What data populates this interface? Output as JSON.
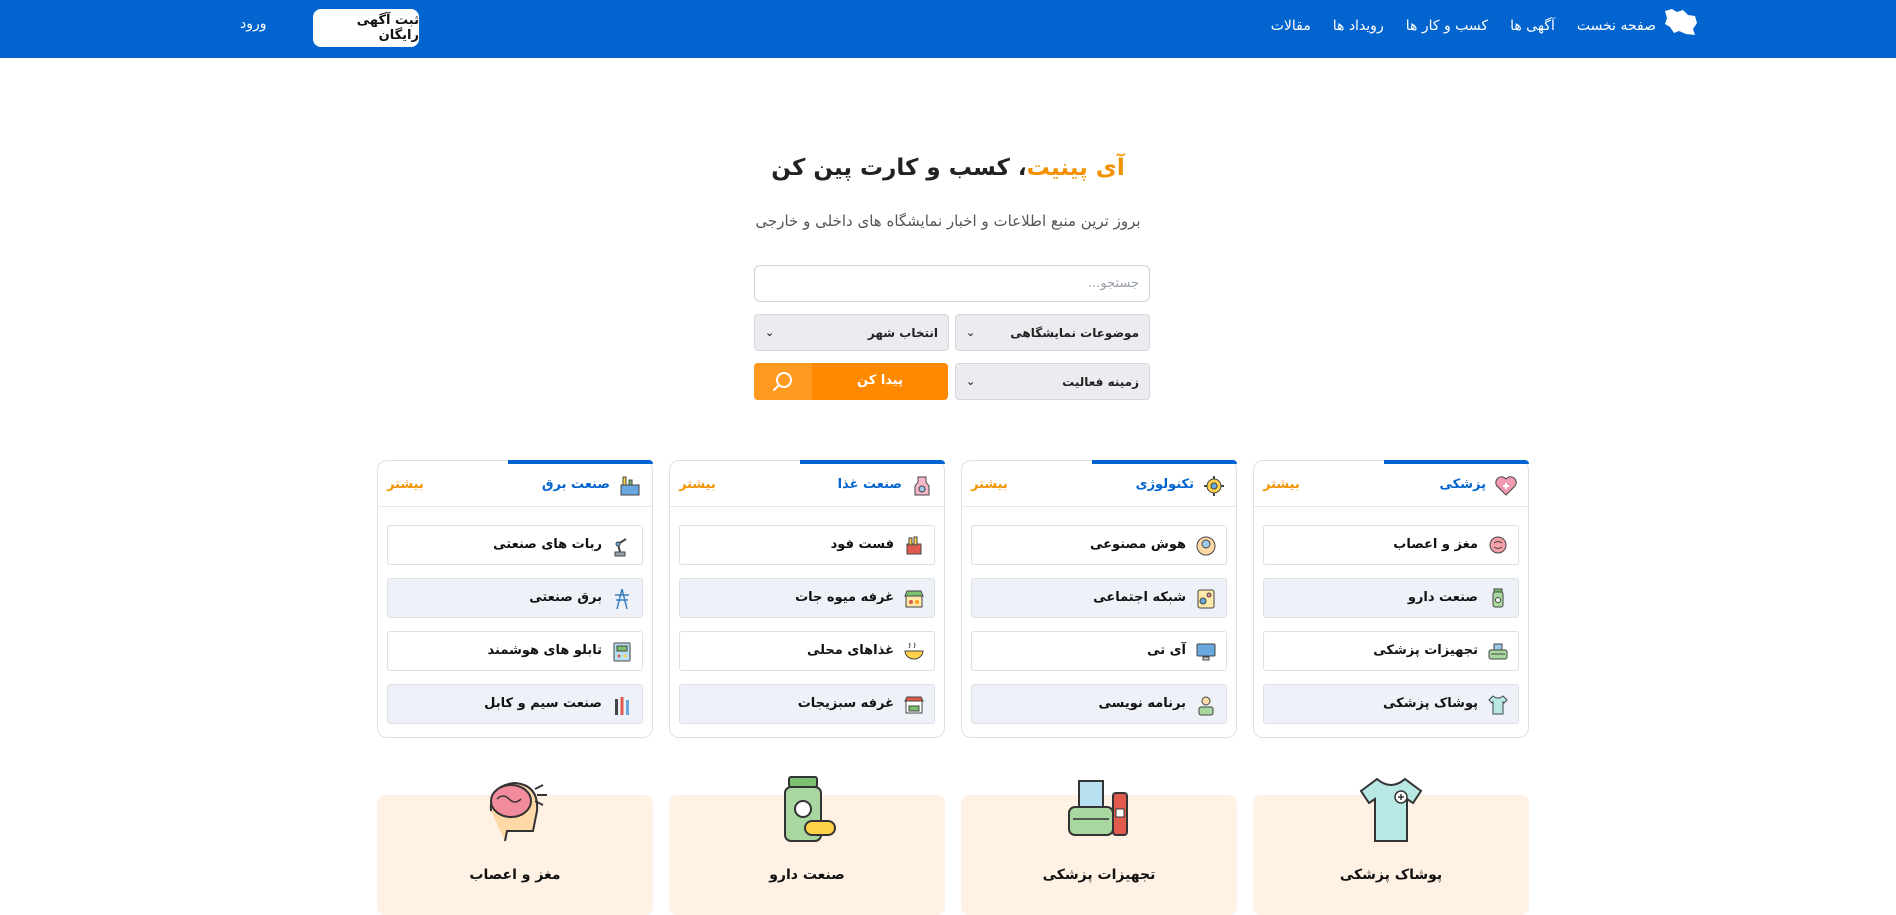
{
  "header": {
    "nav": [
      "صفحه نخست",
      "آگهی ها",
      "کسب و کار ها",
      "رویداد ها",
      "مقالات"
    ],
    "free_ad_label": "ثبت آگهی رایگان",
    "login_label": "ورود",
    "logo_icon": "iran-map-icon"
  },
  "hero": {
    "title_accent": "آی پینیت",
    "title_rest": "، کسب و کارت پین کن",
    "subtitle": "بروز ترین منبع اطلاعات و اخبار نمایشگاه های داخلی و خارجی"
  },
  "search": {
    "placeholder": "جستجو...",
    "topic_select": "موضوعات نمایشگاهی",
    "city_select": "انتخاب شهر",
    "field_select": "زمینه فعالیت",
    "find_label": "پیدا کن"
  },
  "categories": [
    {
      "title": "پزشکی",
      "more": "بیشتر",
      "icon": "heart-medical-icon",
      "items": [
        {
          "label": "مغز و اعصاب",
          "icon": "brain-icon"
        },
        {
          "label": "صنعت دارو",
          "icon": "medicine-icon"
        },
        {
          "label": "تجهیزات پزشکی",
          "icon": "medical-equipment-icon"
        },
        {
          "label": "پوشاک پزشکی",
          "icon": "medical-shirt-icon"
        }
      ]
    },
    {
      "title": "تکنولوژی",
      "more": "بیشتر",
      "icon": "tech-gear-icon",
      "items": [
        {
          "label": "هوش مصنوعی",
          "icon": "ai-head-icon"
        },
        {
          "label": "شبکه اجتماعی",
          "icon": "social-network-icon"
        },
        {
          "label": "آی تی",
          "icon": "monitor-icon"
        },
        {
          "label": "برنامه نویسی",
          "icon": "programmer-icon"
        }
      ]
    },
    {
      "title": "صنعت غذا",
      "more": "بیشتر",
      "icon": "food-industry-icon",
      "items": [
        {
          "label": "فست فود",
          "icon": "fast-food-icon"
        },
        {
          "label": "غرفه میوه جات",
          "icon": "fruit-stand-icon"
        },
        {
          "label": "غذاهای محلی",
          "icon": "local-food-icon"
        },
        {
          "label": "غرفه سبزیجات",
          "icon": "vegetable-stand-icon"
        }
      ]
    },
    {
      "title": "صنعت برق",
      "more": "بیشتر",
      "icon": "factory-icon",
      "items": [
        {
          "label": "ربات های صنعتی",
          "icon": "robot-arm-icon"
        },
        {
          "label": "برق صنعتی",
          "icon": "power-tower-icon"
        },
        {
          "label": "تابلو های هوشمند",
          "icon": "smart-panel-icon"
        },
        {
          "label": "صنعت سیم و کابل",
          "icon": "cable-icon"
        }
      ]
    }
  ],
  "features": [
    {
      "label": "پوشاک پزشکی",
      "icon": "medical-shirt-icon"
    },
    {
      "label": "تجهیزات پزشکی",
      "icon": "medical-equipment-icon"
    },
    {
      "label": "صنعت دارو",
      "icon": "medicine-icon"
    },
    {
      "label": "مغز و اعصاب",
      "icon": "brain-icon"
    }
  ],
  "colors": {
    "brand_blue": "#0264cf",
    "accent_orange": "#f39200",
    "button_orange": "#ff8a00",
    "feature_bg": "#fff1e3",
    "alt_row": "#eef1f8"
  }
}
